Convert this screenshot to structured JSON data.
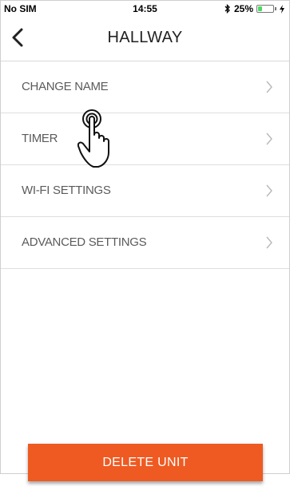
{
  "status_bar": {
    "carrier": "No SIM",
    "time": "14:55",
    "battery_text": "25%",
    "battery_level": 0.25,
    "icons": [
      "bluetooth-icon",
      "battery-icon",
      "charging-icon"
    ]
  },
  "nav": {
    "title": "HALLWAY",
    "back_icon": "chevron-left-icon"
  },
  "menu": [
    {
      "label": "CHANGE NAME"
    },
    {
      "label": "TIMER"
    },
    {
      "label": "WI-FI SETTINGS"
    },
    {
      "label": "ADVANCED SETTINGS"
    }
  ],
  "delete_button": {
    "label": "DELETE UNIT"
  },
  "colors": {
    "accent": "#ee5a22",
    "battery": "#4cd964",
    "text": "#5b5b5b"
  }
}
